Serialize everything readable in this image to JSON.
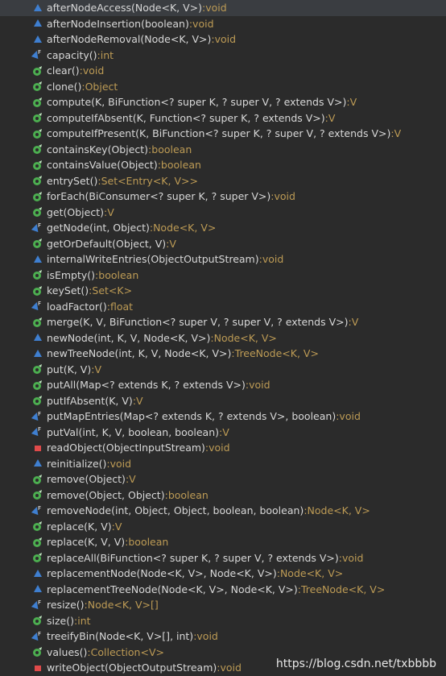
{
  "outline": {
    "items": [
      {
        "signature": "afterNodeAccess(Node<K, V>)",
        "return_type": "void",
        "icon": "default"
      },
      {
        "signature": "afterNodeInsertion(boolean)",
        "return_type": "void",
        "icon": "default"
      },
      {
        "signature": "afterNodeRemoval(Node<K, V>)",
        "return_type": "void",
        "icon": "default"
      },
      {
        "signature": "capacity()",
        "return_type": "int",
        "icon": "final"
      },
      {
        "signature": "clear()",
        "return_type": "void",
        "icon": "public"
      },
      {
        "signature": "clone()",
        "return_type": "Object",
        "icon": "public"
      },
      {
        "signature": "compute(K, BiFunction<? super K, ? super V, ? extends V>)",
        "return_type": "V",
        "icon": "public"
      },
      {
        "signature": "computeIfAbsent(K, Function<? super K, ? extends V>)",
        "return_type": "V",
        "icon": "public"
      },
      {
        "signature": "computeIfPresent(K, BiFunction<? super K, ? super V, ? extends V>)",
        "return_type": "V",
        "icon": "public"
      },
      {
        "signature": "containsKey(Object)",
        "return_type": "boolean",
        "icon": "public"
      },
      {
        "signature": "containsValue(Object)",
        "return_type": "boolean",
        "icon": "public"
      },
      {
        "signature": "entrySet()",
        "return_type": "Set<Entry<K, V>>",
        "icon": "public"
      },
      {
        "signature": "forEach(BiConsumer<? super K, ? super V>)",
        "return_type": "void",
        "icon": "public"
      },
      {
        "signature": "get(Object)",
        "return_type": "V",
        "icon": "public"
      },
      {
        "signature": "getNode(int, Object)",
        "return_type": "Node<K, V>",
        "icon": "final"
      },
      {
        "signature": "getOrDefault(Object, V)",
        "return_type": "V",
        "icon": "public"
      },
      {
        "signature": "internalWriteEntries(ObjectOutputStream)",
        "return_type": "void",
        "icon": "default"
      },
      {
        "signature": "isEmpty()",
        "return_type": "boolean",
        "icon": "public"
      },
      {
        "signature": "keySet()",
        "return_type": "Set<K>",
        "icon": "public"
      },
      {
        "signature": "loadFactor()",
        "return_type": "float",
        "icon": "final"
      },
      {
        "signature": "merge(K, V, BiFunction<? super V, ? super V, ? extends V>)",
        "return_type": "V",
        "icon": "public"
      },
      {
        "signature": "newNode(int, K, V, Node<K, V>)",
        "return_type": "Node<K, V>",
        "icon": "default"
      },
      {
        "signature": "newTreeNode(int, K, V, Node<K, V>)",
        "return_type": "TreeNode<K, V>",
        "icon": "default"
      },
      {
        "signature": "put(K, V)",
        "return_type": "V",
        "icon": "public"
      },
      {
        "signature": "putAll(Map<? extends K, ? extends V>)",
        "return_type": "void",
        "icon": "public"
      },
      {
        "signature": "putIfAbsent(K, V)",
        "return_type": "V",
        "icon": "public"
      },
      {
        "signature": "putMapEntries(Map<? extends K, ? extends V>, boolean)",
        "return_type": "void",
        "icon": "final"
      },
      {
        "signature": "putVal(int, K, V, boolean, boolean)",
        "return_type": "V",
        "icon": "final"
      },
      {
        "signature": "readObject(ObjectInputStream)",
        "return_type": "void",
        "icon": "private"
      },
      {
        "signature": "reinitialize()",
        "return_type": "void",
        "icon": "default"
      },
      {
        "signature": "remove(Object)",
        "return_type": "V",
        "icon": "public"
      },
      {
        "signature": "remove(Object, Object)",
        "return_type": "boolean",
        "icon": "public"
      },
      {
        "signature": "removeNode(int, Object, Object, boolean, boolean)",
        "return_type": "Node<K, V>",
        "icon": "final"
      },
      {
        "signature": "replace(K, V)",
        "return_type": "V",
        "icon": "public"
      },
      {
        "signature": "replace(K, V, V)",
        "return_type": "boolean",
        "icon": "public"
      },
      {
        "signature": "replaceAll(BiFunction<? super K, ? super V, ? extends V>)",
        "return_type": "void",
        "icon": "public"
      },
      {
        "signature": "replacementNode(Node<K, V>, Node<K, V>)",
        "return_type": "Node<K, V>",
        "icon": "default"
      },
      {
        "signature": "replacementTreeNode(Node<K, V>, Node<K, V>)",
        "return_type": "TreeNode<K, V>",
        "icon": "default"
      },
      {
        "signature": "resize()",
        "return_type": "Node<K, V>[]",
        "icon": "final"
      },
      {
        "signature": "size()",
        "return_type": "int",
        "icon": "public"
      },
      {
        "signature": "treeifyBin(Node<K, V>[], int)",
        "return_type": "void",
        "icon": "final"
      },
      {
        "signature": "values()",
        "return_type": "Collection<V>",
        "icon": "public"
      },
      {
        "signature": "writeObject(ObjectOutputStream)",
        "return_type": "void",
        "icon": "private"
      }
    ],
    "separator": " : "
  },
  "watermark": "https://blog.csdn.net/txbbbb",
  "colors": {
    "background": "#2b2b2b",
    "signature": "#d8d8d8",
    "return_type": "#bd9b55",
    "icon_default": "#3f7fd0",
    "icon_public": "#4caf50",
    "icon_private": "#e04a4a",
    "icon_final": "#3f7fd0"
  }
}
